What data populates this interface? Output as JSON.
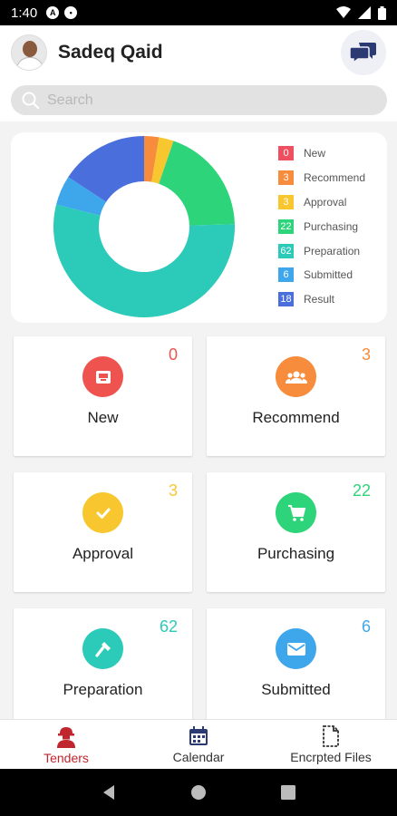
{
  "status_bar": {
    "time": "1:40"
  },
  "header": {
    "user_name": "Sadeq Qaid"
  },
  "search": {
    "placeholder": "Search"
  },
  "chart_data": {
    "type": "pie",
    "categories": [
      "New",
      "Recommend",
      "Approval",
      "Purchasing",
      "Preparation",
      "Submitted",
      "Result"
    ],
    "values": [
      0,
      3,
      3,
      22,
      62,
      6,
      18
    ],
    "colors": [
      "#ef4f5f",
      "#f68c3c",
      "#f8c72f",
      "#2ed47a",
      "#2ccab8",
      "#3ea7ec",
      "#4a6fdc"
    ]
  },
  "tiles": [
    {
      "label": "New",
      "count": "0",
      "color": "#ef5350",
      "icon": "inbox-icon"
    },
    {
      "label": "Recommend",
      "count": "3",
      "color": "#f68c3c",
      "icon": "group-icon"
    },
    {
      "label": "Approval",
      "count": "3",
      "color": "#f8c72f",
      "icon": "check-icon"
    },
    {
      "label": "Purchasing",
      "count": "22",
      "color": "#2ed47a",
      "icon": "cart-icon"
    },
    {
      "label": "Preparation",
      "count": "62",
      "color": "#2ccab8",
      "icon": "hammer-icon"
    },
    {
      "label": "Submitted",
      "count": "6",
      "color": "#3ea7ec",
      "icon": "mail-icon"
    }
  ],
  "bottom_nav": [
    {
      "label": "Tenders",
      "icon": "worker-icon",
      "active": true
    },
    {
      "label": "Calendar",
      "icon": "calendar-icon",
      "active": false
    },
    {
      "label": "Encrpted Files",
      "icon": "file-icon",
      "active": false
    }
  ]
}
